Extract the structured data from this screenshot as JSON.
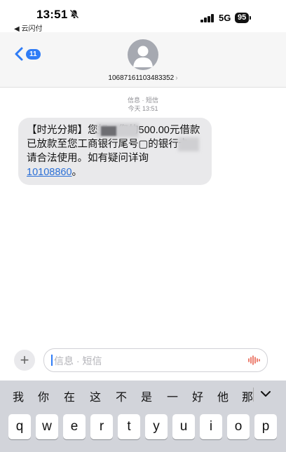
{
  "status_bar": {
    "time": "13:51",
    "back_app": "◀ 云闪付",
    "network": "5G",
    "battery": "95"
  },
  "header": {
    "back_badge": "11",
    "contact_number": "10687161103483352"
  },
  "conversation": {
    "service_label": "信息 · 短信",
    "timestamp": "今天 13:51",
    "message": {
      "segment_1": "【时光分期】",
      "segment_2": "您好，您的500.00元借款已放款至您工商银行尾号",
      "segment_3": "的银行卡，请合法使用。如有疑问详询",
      "link": "10108860",
      "segment_4": "。"
    }
  },
  "composer": {
    "placeholder": "信息 · 短信"
  },
  "keyboard": {
    "candidates": [
      "我",
      "你",
      "在",
      "这",
      "不",
      "是",
      "一",
      "好",
      "他",
      "那"
    ],
    "row1": [
      "q",
      "w",
      "e",
      "r",
      "t",
      "y",
      "u",
      "i",
      "o",
      "p"
    ]
  },
  "colors": {
    "accent": "#2f7cf6",
    "bubble": "#e9e9eb",
    "keyboard_bg": "#d2d4da"
  }
}
